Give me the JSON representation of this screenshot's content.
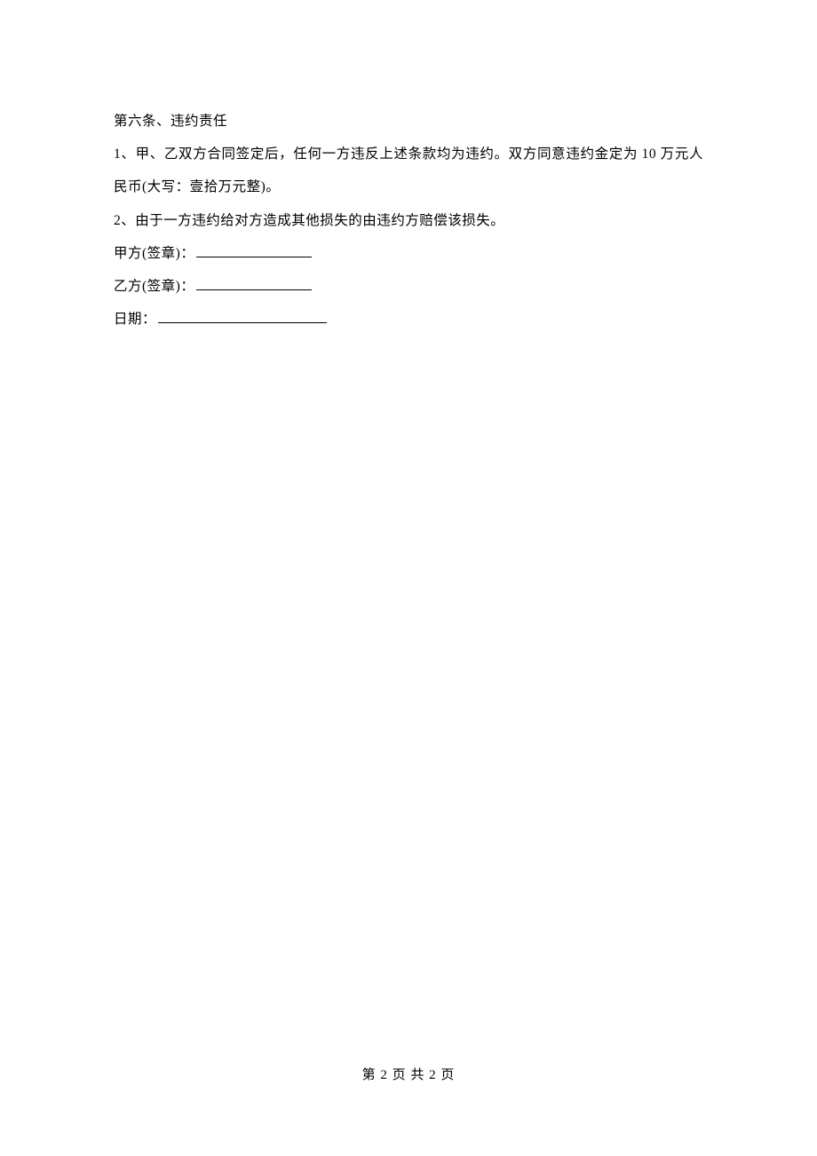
{
  "article6": {
    "heading": "第六条、违约责任",
    "clause1": "1、甲、乙双方合同签定后，任何一方违反上述条款均为违约。双方同意违约金定为 10 万元人民币(大写：壹拾万元整)。",
    "clause2": "2、由于一方违约给对方造成其他损失的由违约方赔偿该损失。"
  },
  "signatures": {
    "partyA_label": "甲方(签章)：",
    "partyB_label": "乙方(签章)：",
    "date_label": "日期："
  },
  "footer": {
    "page_text": "第 2 页  共  2 页"
  }
}
